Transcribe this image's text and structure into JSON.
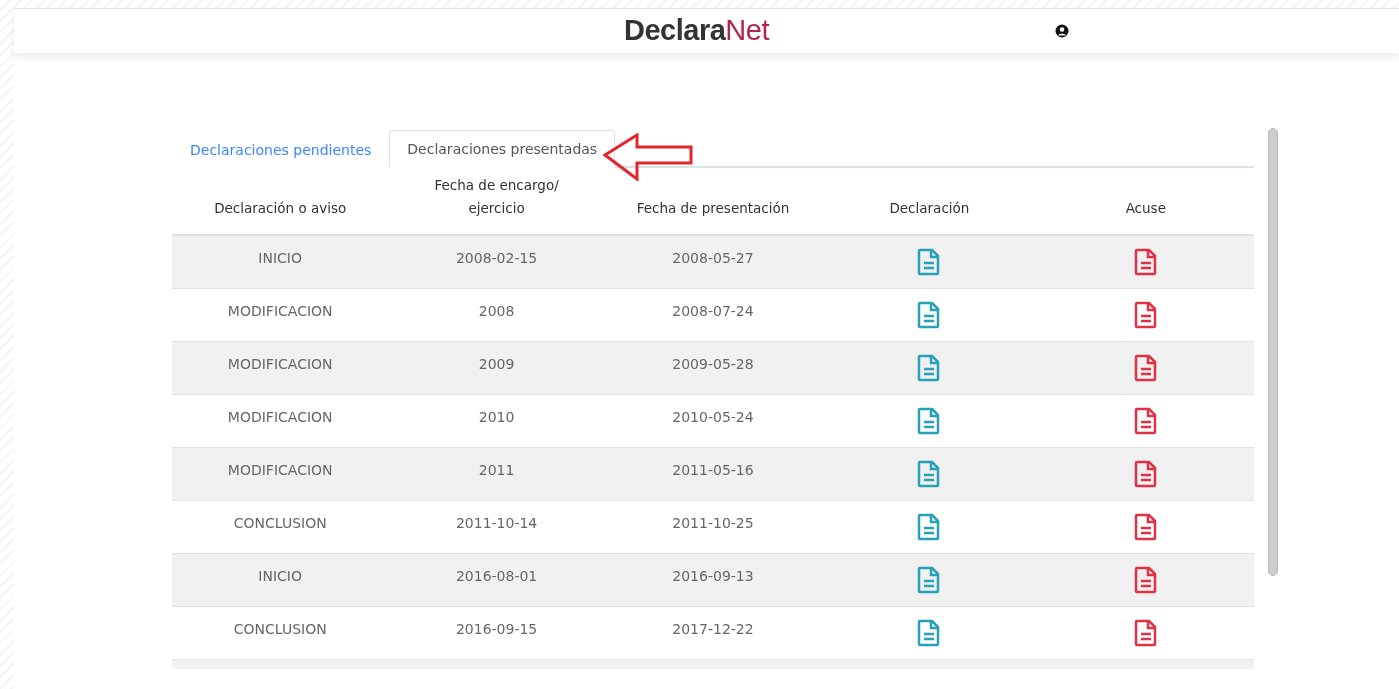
{
  "header": {
    "logo_bold": "Declara",
    "logo_light": "Net"
  },
  "tabs": [
    {
      "label": "Declaraciones pendientes",
      "selected": false
    },
    {
      "label": "Declaraciones presentadas",
      "selected": true
    }
  ],
  "table": {
    "columns": [
      "Declaración o aviso",
      "Fecha de encargo/ ejercicio",
      "Fecha de presentación",
      "Declaración",
      "Acuse"
    ],
    "rows": [
      {
        "type": "INICIO",
        "period": "2008-02-15",
        "date": "2008-05-27"
      },
      {
        "type": "MODIFICACION",
        "period": "2008",
        "date": "2008-07-24"
      },
      {
        "type": "MODIFICACION",
        "period": "2009",
        "date": "2009-05-28"
      },
      {
        "type": "MODIFICACION",
        "period": "2010",
        "date": "2010-05-24"
      },
      {
        "type": "MODIFICACION",
        "period": "2011",
        "date": "2011-05-16"
      },
      {
        "type": "CONCLUSION",
        "period": "2011-10-14",
        "date": "2011-10-25"
      },
      {
        "type": "INICIO",
        "period": "2016-08-01",
        "date": "2016-09-13"
      },
      {
        "type": "CONCLUSION",
        "period": "2016-09-15",
        "date": "2017-12-22"
      }
    ]
  }
}
